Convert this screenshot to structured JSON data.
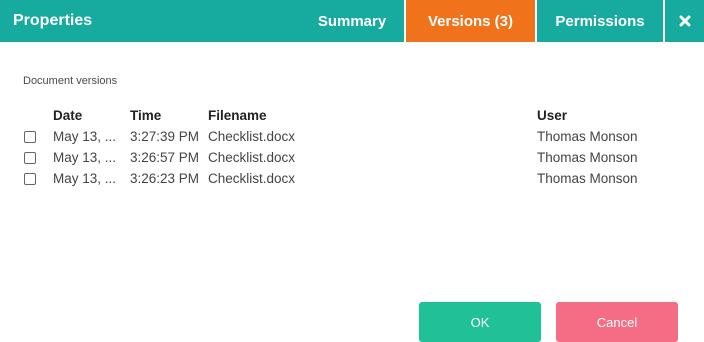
{
  "dialog": {
    "title": "Properties",
    "tabs": [
      {
        "label": "Summary",
        "active": false
      },
      {
        "label": "Versions (3)",
        "active": true
      },
      {
        "label": "Permissions",
        "active": false
      }
    ],
    "close_icon": "close-x-icon",
    "colors": {
      "titlebar": "#17aa9e",
      "active_tab": "#f0731c",
      "ok_button": "#21c197",
      "cancel_button": "#f46d84"
    }
  },
  "versions": {
    "section_label": "Document versions",
    "columns": [
      "Date",
      "Time",
      "Filename",
      "User"
    ],
    "rows": [
      {
        "date": "May 13, ...",
        "time": "3:27:39 PM",
        "filename": "Checklist.docx",
        "user": "Thomas Monson",
        "checked": false
      },
      {
        "date": "May 13, ...",
        "time": "3:26:57 PM",
        "filename": "Checklist.docx",
        "user": "Thomas Monson",
        "checked": false
      },
      {
        "date": "May 13, ...",
        "time": "3:26:23 PM",
        "filename": "Checklist.docx",
        "user": "Thomas Monson",
        "checked": false
      }
    ]
  },
  "buttons": {
    "ok_label": "OK",
    "cancel_label": "Cancel"
  }
}
